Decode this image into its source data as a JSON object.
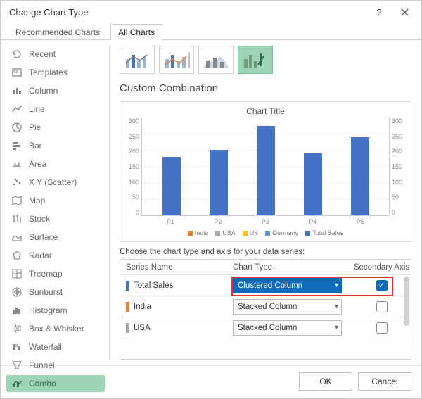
{
  "window": {
    "title": "Change Chart Type"
  },
  "tabs": {
    "recommended": "Recommended Charts",
    "all": "All Charts"
  },
  "sidebar": {
    "items": [
      "Recent",
      "Templates",
      "Column",
      "Line",
      "Pie",
      "Bar",
      "Area",
      "X Y (Scatter)",
      "Map",
      "Stock",
      "Surface",
      "Radar",
      "Treemap",
      "Sunburst",
      "Histogram",
      "Box & Whisker",
      "Waterfall",
      "Funnel",
      "Combo"
    ]
  },
  "main": {
    "section_title": "Custom Combination",
    "chart_title": "Chart Title",
    "hint": "Choose the chart type and axis for your data series:",
    "head": {
      "name": "Series Name",
      "type": "Chart Type",
      "axis": "Secondary Axis"
    },
    "rows": [
      {
        "name": "Total Sales",
        "type": "Clustered Column",
        "color": "#4472c4"
      },
      {
        "name": "India",
        "type": "Stacked Column",
        "color": "#ed7d31"
      },
      {
        "name": "USA",
        "type": "Stacked Column",
        "color": "#a5a5a5"
      }
    ]
  },
  "footer": {
    "ok": "OK",
    "cancel": "Cancel"
  },
  "chart_data": {
    "type": "bar",
    "title": "Chart Title",
    "categories": [
      "P1",
      "P2",
      "P3",
      "P4",
      "P5"
    ],
    "series": [
      {
        "name": "India",
        "color": "#ed7d31"
      },
      {
        "name": "USA",
        "color": "#a5a5a5"
      },
      {
        "name": "UK",
        "color": "#ffc000"
      },
      {
        "name": "Germany",
        "color": "#5b9bd5"
      },
      {
        "name": "Total Sales",
        "color": "#4472c4",
        "values": [
          180,
          200,
          275,
          190,
          240
        ]
      }
    ],
    "ylim_left": [
      0,
      300
    ],
    "ylim_right": [
      0,
      300
    ],
    "yticks": [
      300,
      250,
      200,
      150,
      100,
      50,
      0
    ]
  }
}
